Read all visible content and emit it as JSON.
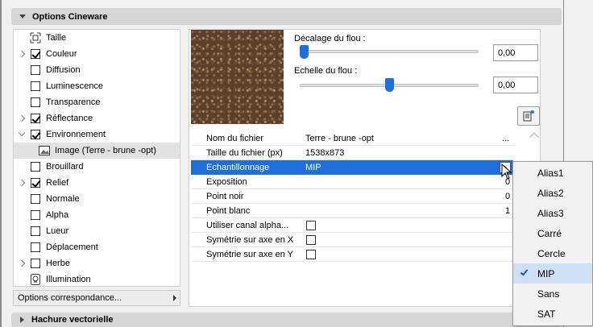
{
  "sections": {
    "top_title": "Options Cineware",
    "bottom_title": "Hachure vectorielle"
  },
  "channels": [
    {
      "label": "Taille",
      "icon": "resize-icon",
      "checked": null,
      "expand": false
    },
    {
      "label": "Couleur",
      "checked": true,
      "expand": true
    },
    {
      "label": "Diffusion",
      "checked": false,
      "expand": false
    },
    {
      "label": "Luminescence",
      "checked": false,
      "expand": false
    },
    {
      "label": "Transparence",
      "checked": false,
      "expand": false
    },
    {
      "label": "Réflectance",
      "checked": true,
      "expand": true
    },
    {
      "label": "Environnement",
      "checked": true,
      "expand": "open"
    },
    {
      "label": "Image (Terre - brune -opt)",
      "icon": "image-icon",
      "checked": null,
      "selected": true
    },
    {
      "label": "Brouillard",
      "checked": false,
      "expand": false
    },
    {
      "label": "Relief",
      "checked": true,
      "expand": true
    },
    {
      "label": "Normale",
      "checked": false,
      "expand": false
    },
    {
      "label": "Alpha",
      "checked": false,
      "expand": false
    },
    {
      "label": "Lueur",
      "checked": false,
      "expand": false
    },
    {
      "label": "Déplacement",
      "checked": false,
      "expand": false
    },
    {
      "label": "Herbe",
      "checked": false,
      "expand": true
    },
    {
      "label": "Illumination",
      "icon": "bulb-icon",
      "checked": null,
      "expand": false
    }
  ],
  "options_dropdown": "Options correspondance...",
  "blur": {
    "offset_label": "Décalage du flou :",
    "offset_value": "0,00",
    "offset_level": 0.0,
    "scale_label": "Echelle du flou :",
    "scale_value": "0,00",
    "scale_level": 0.5
  },
  "properties": [
    {
      "key": "Nom du fichier",
      "value": "Terre - brune -opt",
      "extra": "..."
    },
    {
      "key": "Taille du fichier (px)",
      "value": "1538x873"
    },
    {
      "key": "Echantillonnage",
      "value": "MIP",
      "selected": true
    },
    {
      "key": "Exposition",
      "trail": "0"
    },
    {
      "key": "Point noir",
      "trail": "0"
    },
    {
      "key": "Point blanc",
      "trail": "1"
    },
    {
      "key": "Utiliser canal alpha...",
      "checkbox": true
    },
    {
      "key": "Symétrie sur axe en X",
      "checkbox": true
    },
    {
      "key": "Symétrie sur axe en Y",
      "checkbox": true
    }
  ],
  "sampling_menu": {
    "items": [
      "Alias1",
      "Alias2",
      "Alias3",
      "Carré",
      "Cercle",
      "MIP",
      "Sans",
      "SAT"
    ],
    "selected": "MIP"
  },
  "colors": {
    "accent": "#1e6fd9",
    "header_bg": "#d6d6d6",
    "selected_row": "#1e6fd9"
  }
}
